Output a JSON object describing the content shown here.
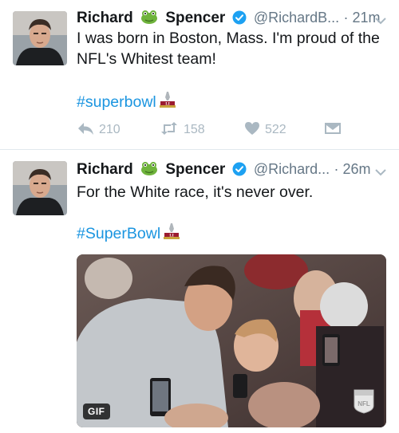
{
  "tweets": [
    {
      "name_first": "Richard",
      "name_last": "Spencer",
      "handle": "@RichardB...",
      "time": "· 21m",
      "text": "I was born in Boston, Mass. I'm proud of the NFL's Whitest team!",
      "hashtag": "#superbowl",
      "actions": {
        "reply_count": "210",
        "retweet_count": "158",
        "like_count": "522"
      }
    },
    {
      "name_first": "Richard",
      "name_last": "Spencer",
      "handle": "@Richard...",
      "time": "· 26m",
      "text": "For the White race, it's never over.",
      "hashtag": "#SuperBowl",
      "media": {
        "badge": "GIF"
      }
    }
  ],
  "colors": {
    "link": "#1b95e0",
    "muted": "#657786",
    "action": "#aab8c2",
    "verified": "#1da1f2"
  },
  "icons": [
    "frog-emoji",
    "verified-badge",
    "superbowl-trophy",
    "reply-icon",
    "retweet-icon",
    "like-icon",
    "dm-icon",
    "caret-down-icon",
    "nfl-logo"
  ]
}
